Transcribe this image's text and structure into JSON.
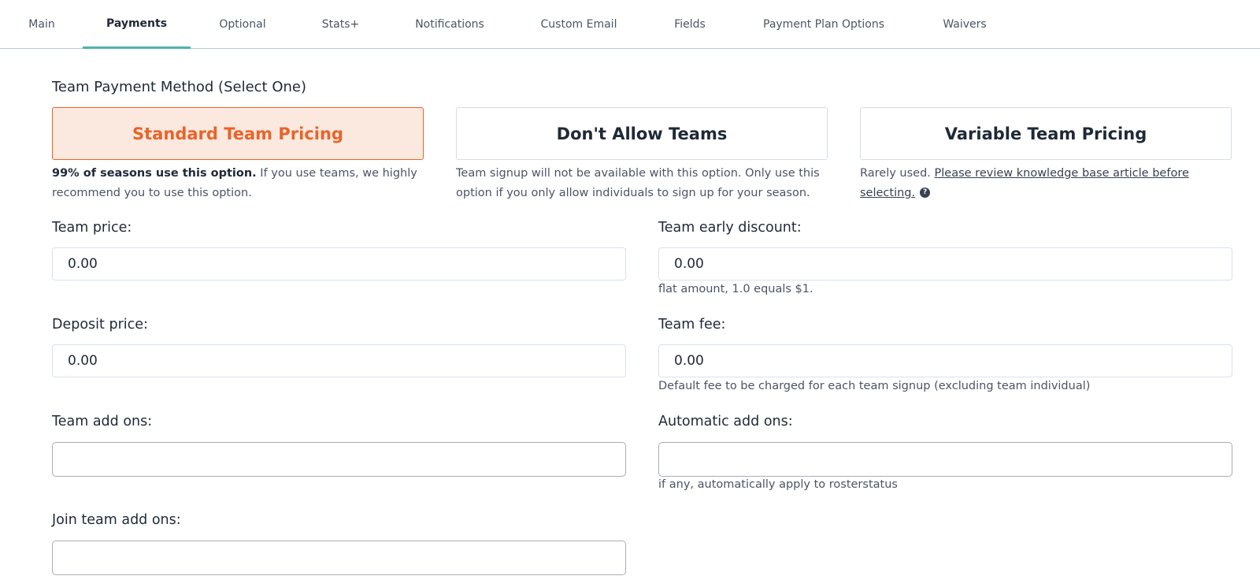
{
  "tabs": [
    {
      "label": "Main"
    },
    {
      "label": "Payments"
    },
    {
      "label": "Optional"
    },
    {
      "label": "Stats+"
    },
    {
      "label": "Notifications"
    },
    {
      "label": "Custom Email"
    },
    {
      "label": "Fields"
    },
    {
      "label": "Payment Plan Options"
    },
    {
      "label": "Waivers"
    }
  ],
  "active_tab": "Payments",
  "payment_method": {
    "title": "Team Payment Method (Select One)",
    "selected": "Standard Team Pricing",
    "options": [
      {
        "label": "Standard Team Pricing",
        "desc_bold": "99% of seasons use this option.",
        "desc_rest": " If you use teams, we highly recommend you to use this option."
      },
      {
        "label": "Don't Allow Teams",
        "desc": "Team signup will not be available with this option. Only use this option if you only allow individuals to sign up for your season."
      },
      {
        "label": "Variable Team Pricing",
        "desc_prefix": "Rarely used. ",
        "desc_link": "Please review knowledge base article before selecting."
      }
    ]
  },
  "fields": {
    "team_price": {
      "label": "Team price:",
      "value": "0.00"
    },
    "team_early_discount": {
      "label": "Team early discount:",
      "value": "0.00",
      "hint": "flat amount, 1.0 equals $1."
    },
    "deposit_price": {
      "label": "Deposit price:",
      "value": "0.00"
    },
    "team_fee": {
      "label": "Team fee:",
      "value": "0.00",
      "hint": "Default fee to be charged for each team signup (excluding team individual)"
    },
    "team_add_ons": {
      "label": "Team add ons:"
    },
    "automatic_add_ons": {
      "label": "Automatic add ons:",
      "hint": "if any, automatically apply to rosterstatus"
    },
    "join_team_add_ons": {
      "label": "Join team add ons:"
    }
  },
  "colors": {
    "accent_orange": "#e8642a",
    "selected_bg": "#fbe9df",
    "tab_underline": "#4fb3ad"
  },
  "icons": {
    "help": "question-circle-icon"
  }
}
